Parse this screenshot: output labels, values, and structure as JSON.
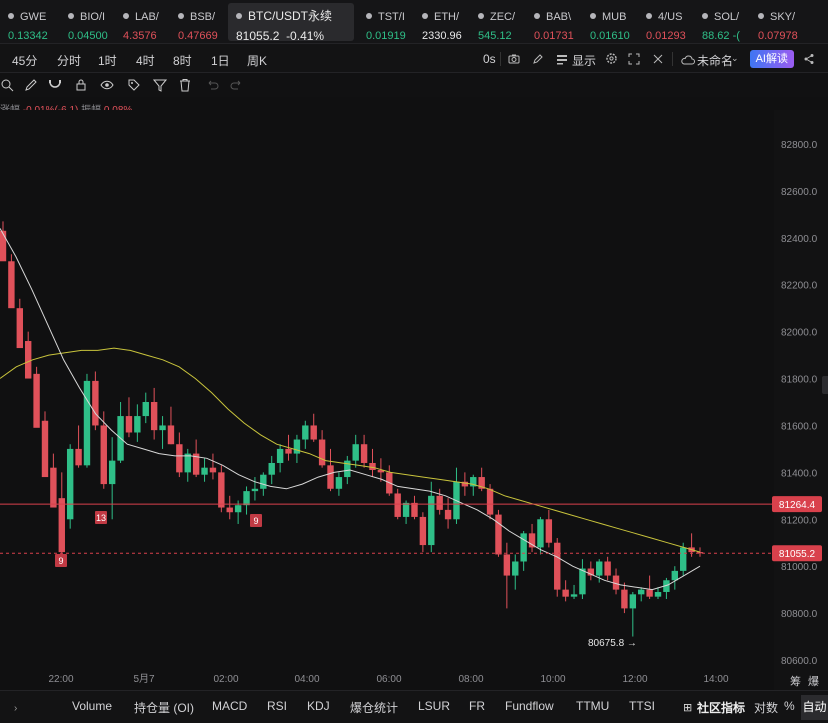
{
  "tickers": [
    {
      "sym": "GWE",
      "price": "0.13342",
      "dir": "green"
    },
    {
      "sym": "BIO/I",
      "price": "0.04500",
      "dir": "green"
    },
    {
      "sym": "LAB/",
      "price": "4.3576",
      "dir": "red"
    },
    {
      "sym": "BSB/",
      "price": "0.47669",
      "dir": "red"
    },
    {
      "sym": "BTC/USDT永续",
      "price": "81055.2",
      "change": "-0.41%",
      "dir": "white",
      "active": true
    },
    {
      "sym": "TST/I",
      "price": "0.01919",
      "dir": "green"
    },
    {
      "sym": "ETH/",
      "price": "2330.96",
      "dir": "white"
    },
    {
      "sym": "ZEC/",
      "price": "545.12",
      "dir": "green"
    },
    {
      "sym": "BAB\\",
      "price": "0.01731",
      "dir": "red"
    },
    {
      "sym": "MUB",
      "price": "0.01610",
      "dir": "green"
    },
    {
      "sym": "4/US",
      "price": "0.01293",
      "dir": "red"
    },
    {
      "sym": "SOL/",
      "price": "88.62",
      "extra": "-(",
      "dir": "green"
    },
    {
      "sym": "SKY/",
      "price": "0.07978",
      "dir": "red"
    }
  ],
  "timeframes": [
    "45分",
    "分时",
    "1时",
    "4时",
    "8时",
    "1日",
    "周K"
  ],
  "toolbar_right": {
    "interval": "0s",
    "display": "显示",
    "layout_name": "未命名",
    "ai": "AI解读"
  },
  "stats": {
    "change_label": "涨幅",
    "change_value": "-0.01%(-6.1)",
    "amplitude_label": "振幅",
    "amplitude_value": "0.08%"
  },
  "chart_data": {
    "type": "candlestick",
    "symbol": "BTC/USDT永续",
    "y_ticks": [
      82800,
      82600,
      82400,
      82200,
      82000,
      81800,
      81600,
      81400,
      81200,
      81000,
      80800,
      80600
    ],
    "y_tick_labels": [
      "82800.0",
      "82600.0",
      "82400.0",
      "82200.0",
      "82000.0",
      "81800.0",
      "81600.0",
      "81400.0",
      "81200.0",
      "81000.0",
      "80800.0",
      "80600.0"
    ],
    "x_labels": [
      "22:00",
      "5月7",
      "02:00",
      "04:00",
      "06:00",
      "08:00",
      "10:00",
      "12:00",
      "14:00"
    ],
    "last_price": 81055.2,
    "last_price_label": "81055.2",
    "horizontal_line": 81264.4,
    "horizontal_line_label": "81264.4",
    "low_marker": "80675.8 →",
    "event_markers": [
      "9",
      "13",
      "9"
    ],
    "candles": [
      [
        82430,
        82470,
        82330,
        82300
      ],
      [
        82300,
        82330,
        82120,
        82100
      ],
      [
        82100,
        82140,
        81960,
        81930
      ],
      [
        81960,
        82000,
        81820,
        81800
      ],
      [
        81820,
        81850,
        81620,
        81590
      ],
      [
        81620,
        81660,
        81420,
        81380
      ],
      [
        81420,
        81480,
        81290,
        81250
      ],
      [
        81290,
        81400,
        81050,
        81060
      ],
      [
        81200,
        81520,
        81160,
        81500
      ],
      [
        81500,
        81600,
        81420,
        81430
      ],
      [
        81430,
        81820,
        81420,
        81790
      ],
      [
        81790,
        81830,
        81580,
        81600
      ],
      [
        81600,
        81660,
        81330,
        81350
      ],
      [
        81350,
        81550,
        81200,
        81450
      ],
      [
        81450,
        81700,
        81440,
        81640
      ],
      [
        81640,
        81720,
        81550,
        81570
      ],
      [
        81570,
        81690,
        81530,
        81640
      ],
      [
        81640,
        81740,
        81610,
        81700
      ],
      [
        81700,
        81760,
        81540,
        81580
      ],
      [
        81580,
        81640,
        81500,
        81600
      ],
      [
        81600,
        81680,
        81520,
        81520
      ],
      [
        81520,
        81570,
        81380,
        81400
      ],
      [
        81400,
        81500,
        81360,
        81480
      ],
      [
        81480,
        81540,
        81380,
        81390
      ],
      [
        81390,
        81460,
        81360,
        81420
      ],
      [
        81420,
        81480,
        81370,
        81400
      ],
      [
        81400,
        81430,
        81230,
        81250
      ],
      [
        81250,
        81300,
        81200,
        81230
      ],
      [
        81230,
        81280,
        81180,
        81260
      ],
      [
        81260,
        81340,
        81220,
        81320
      ],
      [
        81320,
        81380,
        81280,
        81330
      ],
      [
        81330,
        81400,
        81300,
        81390
      ],
      [
        81390,
        81470,
        81350,
        81440
      ],
      [
        81440,
        81520,
        81400,
        81500
      ],
      [
        81500,
        81560,
        81450,
        81480
      ],
      [
        81480,
        81560,
        81440,
        81540
      ],
      [
        81540,
        81620,
        81500,
        81600
      ],
      [
        81600,
        81650,
        81530,
        81540
      ],
      [
        81540,
        81580,
        81420,
        81430
      ],
      [
        81430,
        81500,
        81320,
        81330
      ],
      [
        81330,
        81400,
        81300,
        81380
      ],
      [
        81380,
        81470,
        81350,
        81450
      ],
      [
        81450,
        81560,
        81420,
        81520
      ],
      [
        81520,
        81560,
        81420,
        81440
      ],
      [
        81440,
        81500,
        81380,
        81410
      ],
      [
        81410,
        81460,
        81360,
        81400
      ],
      [
        81400,
        81430,
        81300,
        81310
      ],
      [
        81310,
        81330,
        81200,
        81210
      ],
      [
        81210,
        81280,
        81180,
        81270
      ],
      [
        81270,
        81300,
        81200,
        81210
      ],
      [
        81210,
        81230,
        81060,
        81090
      ],
      [
        81090,
        81360,
        81060,
        81300
      ],
      [
        81300,
        81330,
        81220,
        81240
      ],
      [
        81240,
        81290,
        81160,
        81200
      ],
      [
        81200,
        81420,
        81180,
        81360
      ],
      [
        81360,
        81400,
        81300,
        81340
      ],
      [
        81340,
        81390,
        81300,
        81380
      ],
      [
        81380,
        81420,
        81320,
        81330
      ],
      [
        81330,
        81350,
        81200,
        81220
      ],
      [
        81220,
        81240,
        81040,
        81050
      ],
      [
        81050,
        81100,
        80820,
        80960
      ],
      [
        80960,
        81050,
        80900,
        81020
      ],
      [
        81020,
        81150,
        80980,
        81140
      ],
      [
        81140,
        81180,
        81060,
        81080
      ],
      [
        81080,
        81210,
        81050,
        81200
      ],
      [
        81200,
        81240,
        81080,
        81100
      ],
      [
        81100,
        81120,
        80870,
        80900
      ],
      [
        80900,
        80940,
        80850,
        80870
      ],
      [
        80870,
        80920,
        80860,
        80880
      ],
      [
        80880,
        81030,
        80860,
        80990
      ],
      [
        80990,
        81020,
        80940,
        80960
      ],
      [
        80960,
        81030,
        80930,
        81020
      ],
      [
        81020,
        81040,
        80940,
        80960
      ],
      [
        80960,
        80990,
        80880,
        80900
      ],
      [
        80900,
        80930,
        80800,
        80820
      ],
      [
        80820,
        80890,
        80700,
        80880
      ],
      [
        80880,
        80910,
        80850,
        80900
      ],
      [
        80900,
        80960,
        80860,
        80870
      ],
      [
        80870,
        80910,
        80860,
        80890
      ],
      [
        80890,
        80950,
        80860,
        80940
      ],
      [
        80940,
        81000,
        80900,
        80980
      ],
      [
        80980,
        81100,
        80960,
        81080
      ],
      [
        81080,
        81140,
        81040,
        81060
      ],
      [
        81060,
        81080,
        81040,
        81055
      ]
    ],
    "ma_slow": [
      81800,
      81850,
      81880,
      81900,
      81910,
      81920,
      81920,
      81930,
      81920,
      81900,
      81880,
      81850,
      81800,
      81740,
      81670,
      81610,
      81560,
      81520,
      81500,
      81480,
      81450,
      81440,
      81430,
      81420,
      81400,
      81390,
      81380,
      81370,
      81360,
      81350,
      81330,
      81300,
      81280,
      81260,
      81240,
      81220,
      81200,
      81180,
      81160,
      81140,
      81120,
      81100,
      81080,
      81060
    ],
    "ma_fast": [
      82440,
      82320,
      82180,
      82030,
      81880,
      81760,
      81650,
      81580,
      81520,
      81500,
      81480,
      81470,
      81470,
      81460,
      81430,
      81390,
      81360,
      81340,
      81330,
      81350,
      81380,
      81400,
      81410,
      81390,
      81370,
      81340,
      81330,
      81320,
      81300,
      81270,
      81240,
      81200,
      81150,
      81110,
      81070,
      81040,
      81000,
      80970,
      80940,
      80920,
      80910,
      80900,
      80920,
      80960,
      81000
    ]
  },
  "bottom_tabs": [
    "Volume",
    "持仓量 (OI)",
    "MACD",
    "RSI",
    "KDJ",
    "爆仓统计",
    "LSUR",
    "FR",
    "Fundflow",
    "TTMU",
    "TTSI"
  ],
  "bottom_right": {
    "community": "社区指标",
    "log": "对数",
    "percent": "%",
    "auto": "自动"
  },
  "corner_labels": {
    "left": "筹",
    "right": "爆"
  },
  "colors": {
    "up": "#2fbf88",
    "down": "#e0515a",
    "ma_slow": "#c9c43c",
    "ma_fast": "#d8d8d8",
    "last_line": "#e0515a"
  }
}
